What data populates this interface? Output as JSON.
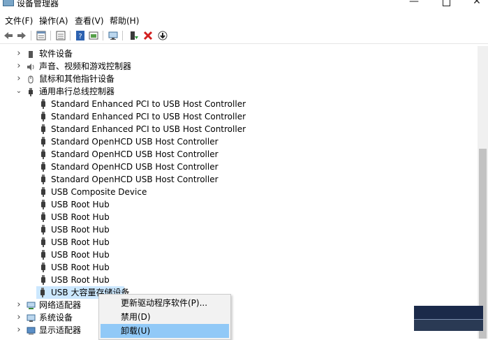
{
  "window": {
    "title": "设备管理器",
    "min": "—",
    "close": "✕"
  },
  "menu": [
    "文件(F)",
    "操作(A)",
    "查看(V)",
    "帮助(H)"
  ],
  "toolbar": {
    "icons": [
      "back-arrow-icon",
      "forward-arrow-icon",
      "properties-icon",
      "list-icon",
      "help-icon",
      "view-icon",
      "monitor-icon",
      "update-driver-icon",
      "uninstall-icon",
      "download-icon"
    ]
  },
  "tree": {
    "categories_top": [
      {
        "label": "软件设备",
        "expanded": false
      },
      {
        "label": "声音、视频和游戏控制器",
        "expanded": false
      },
      {
        "label": "鼠标和其他指针设备",
        "expanded": false
      },
      {
        "label": "通用串行总线控制器",
        "expanded": true
      }
    ],
    "usb_devices": [
      "Standard Enhanced PCI to USB Host Controller",
      "Standard Enhanced PCI to USB Host Controller",
      "Standard Enhanced PCI to USB Host Controller",
      "Standard OpenHCD USB Host Controller",
      "Standard OpenHCD USB Host Controller",
      "Standard OpenHCD USB Host Controller",
      "Standard OpenHCD USB Host Controller",
      "USB Composite Device",
      "USB Root Hub",
      "USB Root Hub",
      "USB Root Hub",
      "USB Root Hub",
      "USB Root Hub",
      "USB Root Hub",
      "USB Root Hub",
      "USB 大容量存储设备"
    ],
    "categories_bottom": [
      {
        "label": "网络适配器",
        "expanded": false
      },
      {
        "label": "系统设备",
        "expanded": false
      },
      {
        "label": "显示适配器",
        "expanded": false
      }
    ]
  },
  "context_menu": {
    "items": [
      "更新驱动程序软件(P)...",
      "禁用(D)",
      "卸载(U)"
    ],
    "highlighted_index": 2
  },
  "colors": {
    "selection": "#cce8ff",
    "menu_highlight": "#91c9f7",
    "uninstall_red": "#d21f1f"
  }
}
